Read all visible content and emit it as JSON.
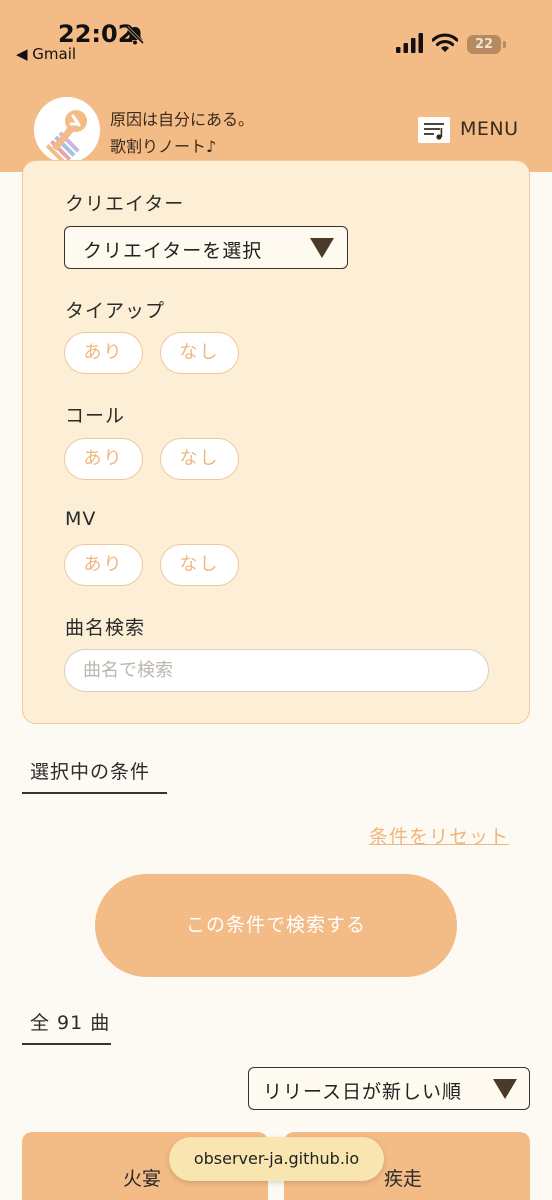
{
  "status_bar": {
    "time": "22:02",
    "back_app": "◀ Gmail",
    "battery": "22"
  },
  "header": {
    "tagline": "原因は自分にある。",
    "site_title": "歌割りノート♪",
    "menu_label": "MENU"
  },
  "filters": {
    "creator_label": "クリエイター",
    "creator_select": "クリエイターを選択",
    "tieup_label": "タイアップ",
    "call_label": "コール",
    "mv_label": "MV",
    "yes": "あり",
    "no": "なし",
    "title_search_label": "曲名検索",
    "title_search_placeholder": "曲名で検索"
  },
  "selected_conditions_title": "選択中の条件",
  "reset_link": "条件をリセット",
  "search_button": "この条件で検索する",
  "result_count": "全 91 曲",
  "sort_select": "リリース日が新しい順",
  "songs": [
    {
      "title": "火宴"
    },
    {
      "title": "疾走"
    }
  ],
  "url_bar": "observer-ja.github.io",
  "colors": {
    "accent": "#f3bb86",
    "panel_bg": "#fcefd6",
    "pill_text": "#efb77f",
    "page_bg": "#fcfaf3"
  }
}
